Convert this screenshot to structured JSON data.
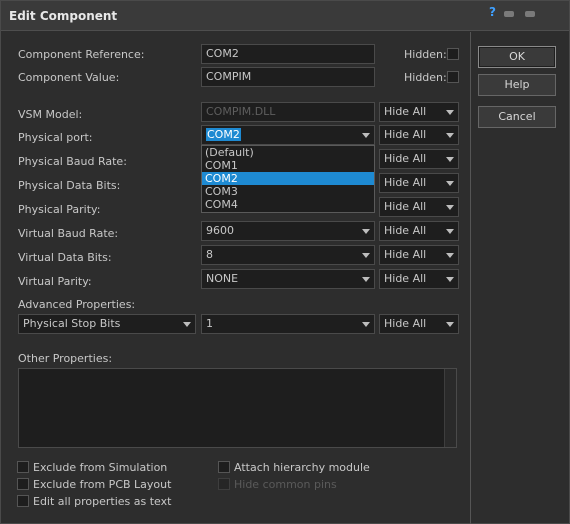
{
  "window": {
    "title": "Edit Component",
    "help_glyph": "?"
  },
  "fields": {
    "component_reference": {
      "label": "Component Reference:",
      "value": "COM2",
      "hidden_label": "Hidden:"
    },
    "component_value": {
      "label": "Component Value:",
      "value": "COMPIM",
      "hidden_label": "Hidden:"
    }
  },
  "properties": [
    {
      "label": "VSM Model:",
      "value": "COMPIM.DLL",
      "vis": "Hide All"
    },
    {
      "label": "Physical port:",
      "value": "COM2",
      "vis": "Hide All"
    },
    {
      "label": "Physical Baud Rate:",
      "value": "",
      "vis": "Hide All"
    },
    {
      "label": "Physical Data Bits:",
      "value": "",
      "vis": "Hide All"
    },
    {
      "label": "Physical Parity:",
      "value": "",
      "vis": "Hide All"
    },
    {
      "label": "Virtual Baud Rate:",
      "value": "9600",
      "vis": "Hide All"
    },
    {
      "label": "Virtual Data Bits:",
      "value": "8",
      "vis": "Hide All"
    },
    {
      "label": "Virtual Parity:",
      "value": "NONE",
      "vis": "Hide All"
    }
  ],
  "dropdown": {
    "options": [
      "(Default)",
      "COM1",
      "COM2",
      "COM3",
      "COM4"
    ],
    "selected": "COM2"
  },
  "advanced": {
    "label": "Advanced Properties:",
    "property": "Physical Stop Bits",
    "value": "1",
    "vis": "Hide All"
  },
  "other": {
    "label": "Other Properties:"
  },
  "checkboxes": {
    "exclude_simulation": "Exclude from Simulation",
    "exclude_pcb": "Exclude from PCB Layout",
    "edit_all": "Edit all properties as text",
    "attach_hierarchy": "Attach hierarchy module",
    "hide_common_pins": "Hide common pins"
  },
  "buttons": {
    "ok": "OK",
    "help": "Help",
    "cancel": "Cancel"
  },
  "colors": {
    "selection": "#1e8ad2",
    "background": "#2d2d2d",
    "field": "#1e1e1e"
  }
}
